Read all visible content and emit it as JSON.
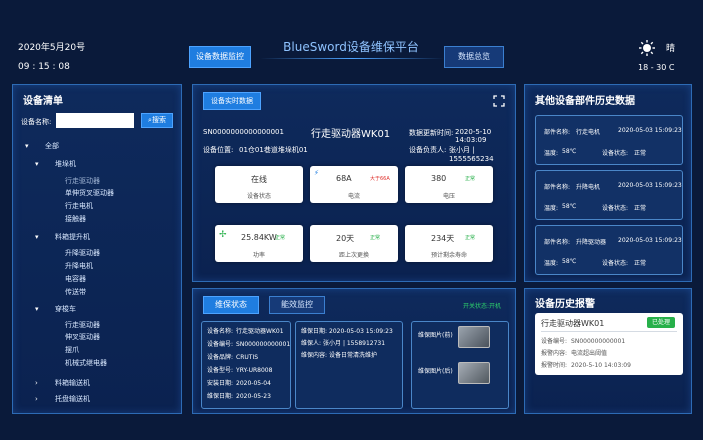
{
  "header": {
    "date": "2020年5月20号",
    "time": "09 : 15 : 08",
    "title": "BlueSword设备维保平台",
    "btn_monitor": "设备数据监控",
    "btn_overview": "数据总览",
    "weather": "晴",
    "temperature": "18 - 30 C"
  },
  "sidebar": {
    "title": "设备清单",
    "name_label": "设备名称:",
    "search_placeholder": "",
    "search_button": "搜索",
    "tree": [
      {
        "label": "全部",
        "level": 0,
        "toggle": "▾"
      },
      {
        "label": "堆垛机",
        "level": 1,
        "toggle": "▾"
      },
      {
        "label": "行走驱动器",
        "level": 2,
        "active": true
      },
      {
        "label": "单伸货叉驱动器",
        "level": 2
      },
      {
        "label": "行走电机",
        "level": 2
      },
      {
        "label": "接触器",
        "level": 2
      },
      {
        "label": "料箱提升机",
        "level": 1,
        "toggle": "▾"
      },
      {
        "label": "升降驱动器",
        "level": 2
      },
      {
        "label": "升降电机",
        "level": 2
      },
      {
        "label": "电容器",
        "level": 2
      },
      {
        "label": "传送带",
        "level": 2
      },
      {
        "label": "穿梭车",
        "level": 1,
        "toggle": "▾"
      },
      {
        "label": "行走驱动器",
        "level": 2
      },
      {
        "label": "伸叉驱动器",
        "level": 2
      },
      {
        "label": "摆爪",
        "level": 2
      },
      {
        "label": "机械式继电器",
        "level": 2
      },
      {
        "label": "料箱输送机",
        "level": 1,
        "toggle": "›"
      },
      {
        "label": "托盘输送机",
        "level": 1,
        "toggle": "›"
      }
    ]
  },
  "realtime": {
    "tab": "设备实时数据",
    "serial": "SN0000000000000001",
    "device_title": "行走驱动器WK01",
    "update_label": "数据更新时间:",
    "update_time": "2020-5-10 14:03:09",
    "location_label": "设备位置:",
    "location": "01仓01巷道堆垛机01",
    "owner_label": "设备负责人:",
    "owner": "张小月 | 1555565234",
    "cards": [
      {
        "value": "在线",
        "label": "设备状态",
        "badge": ""
      },
      {
        "value": "68A",
        "label": "电流",
        "badge": "大于66A"
      },
      {
        "value": "380",
        "label": "电压",
        "badge": "正常"
      },
      {
        "value": "25.84KW",
        "label": "功率",
        "badge": "正常"
      },
      {
        "value": "20天",
        "label": "距上次更换",
        "badge": "正常"
      },
      {
        "value": "234天",
        "label": "预计剩余寿命",
        "badge": "正常"
      }
    ]
  },
  "maintenance": {
    "tab_active": "维保状态",
    "tab_other": "能效监控",
    "switch_label": "开关状态:",
    "switch_value": "开机",
    "info": [
      {
        "k": "设备名称:",
        "v": "行走驱动器WK01"
      },
      {
        "k": "设备编号:",
        "v": "SN000000000001"
      },
      {
        "k": "设备品牌:",
        "v": "CRUTIS"
      },
      {
        "k": "设备型号:",
        "v": "YRY-UR8008"
      },
      {
        "k": "安装日期:",
        "v": "2020-05-04"
      },
      {
        "k": "维保日期:",
        "v": "2020-05-23"
      }
    ],
    "record": [
      {
        "k": "维保日期:",
        "v": "2020-05-03 15:09:23"
      },
      {
        "k": "维保人:",
        "v": "张小月 | 1558912731"
      },
      {
        "k": "维保内容:",
        "v": "设备日常清洗维护"
      }
    ],
    "photo_before": "维保图片(前)",
    "photo_after": "维保图片(后)"
  },
  "history": {
    "title": "其他设备部件历史数据",
    "items": [
      {
        "name_label": "部件名称:",
        "name": "行走电机",
        "time": "2020-05-03 15:09:23",
        "temp_label": "温度:",
        "temp": "58℃",
        "status_label": "设备状态:",
        "status": "正常"
      },
      {
        "name_label": "部件名称:",
        "name": "升降电机",
        "time": "2020-05-03 15:09:23",
        "temp_label": "温度:",
        "temp": "58℃",
        "status_label": "设备状态:",
        "status": "正常"
      },
      {
        "name_label": "部件名称:",
        "name": "升降驱动器",
        "time": "2020-05-03 15:09:23",
        "temp_label": "温度:",
        "temp": "58℃",
        "status_label": "设备状态:",
        "status": "正常"
      }
    ]
  },
  "alarm": {
    "title": "设备历史报警",
    "device": "行走驱动器WK01",
    "badge": "已处理",
    "rows": [
      {
        "k": "设备编号:",
        "v": "SN000000000001"
      },
      {
        "k": "报警内容:",
        "v": "电流超出阈值"
      },
      {
        "k": "报警时间:",
        "v": "2020-5-10 14:03:09"
      }
    ]
  },
  "colors": {
    "accent": "#1f7de0",
    "ok": "#27b04a",
    "warn": "#e0322d"
  }
}
